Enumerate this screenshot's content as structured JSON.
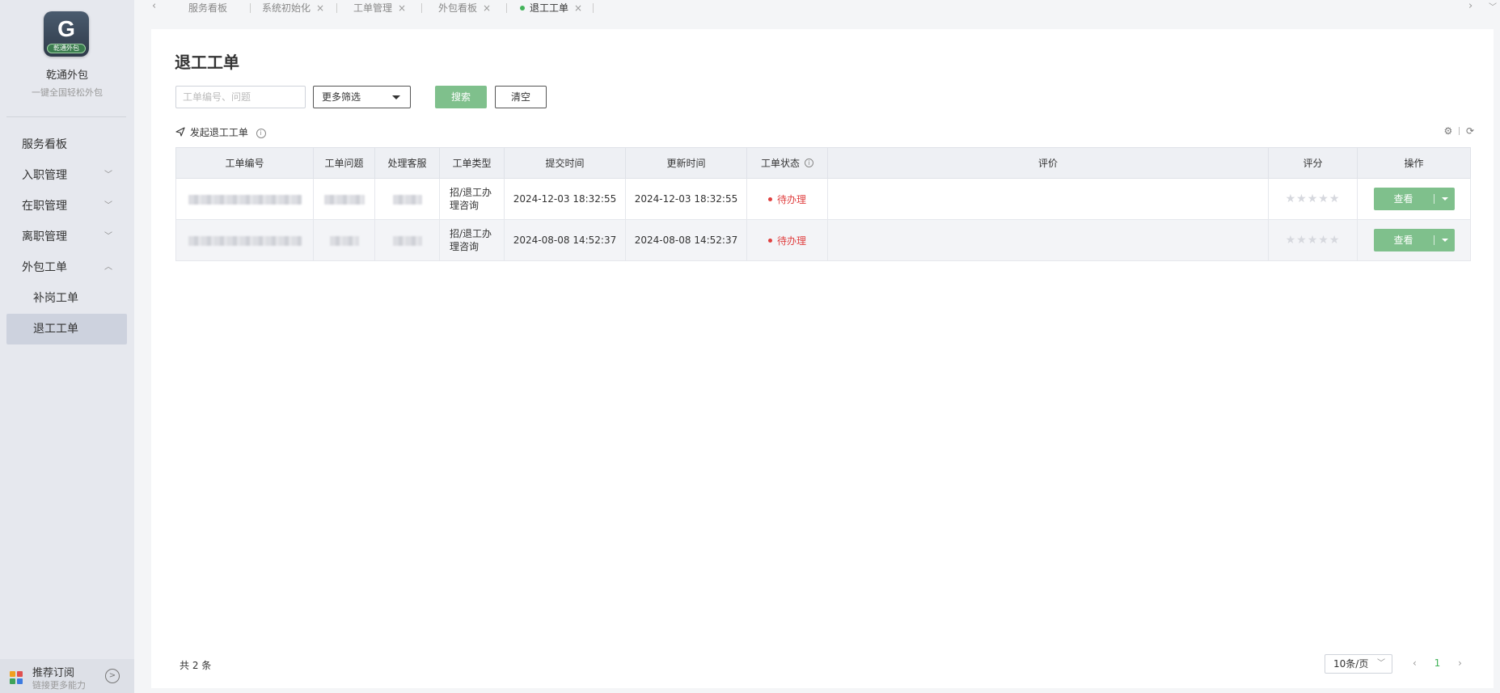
{
  "brand": {
    "logo_letter": "G",
    "logo_tag": "乾通外包",
    "name": "乾通外包",
    "slogan": "一键全国轻松外包"
  },
  "sidebar": {
    "items": [
      {
        "label": "服务看板",
        "chevron": ""
      },
      {
        "label": "入职管理",
        "chevron": "﹀"
      },
      {
        "label": "在职管理",
        "chevron": "﹀"
      },
      {
        "label": "离职管理",
        "chevron": "﹀"
      },
      {
        "label": "外包工单",
        "chevron": "︿"
      },
      {
        "label": "补岗工单",
        "chevron": ""
      },
      {
        "label": "退工工单",
        "chevron": ""
      }
    ],
    "subscription": {
      "title": "推荐订阅",
      "subtitle": "链接更多能力",
      "arrow": ">"
    }
  },
  "tabs": [
    {
      "label": "服务看板"
    },
    {
      "label": "系统初始化",
      "close": "×"
    },
    {
      "label": "工单管理",
      "close": "×"
    },
    {
      "label": "外包看板",
      "close": "×"
    },
    {
      "label": "退工工单",
      "close": "×"
    }
  ],
  "tab_nav": {
    "prev": "‹",
    "next": "›",
    "more": "﹀"
  },
  "page": {
    "title": "退工工单",
    "search_placeholder": "工单编号、问题",
    "filter_label": "更多筛选",
    "search_button": "搜索",
    "clear_button": "清空",
    "launch_label": "发起退工工单",
    "info_glyph": "i",
    "tools": {
      "settings": "⚙",
      "refresh": "⟳"
    }
  },
  "table": {
    "headers": [
      "工单编号",
      "工单问题",
      "处理客服",
      "工单类型",
      "提交时间",
      "更新时间",
      "工单状态",
      "评价",
      "评分",
      "操作"
    ],
    "rows": [
      {
        "type": "招/退工办理咨询",
        "submitted": "2024-12-03 18:32:55",
        "updated": "2024-12-03 18:32:55",
        "status": "待办理",
        "evaluation": "",
        "stars": "★★★★★",
        "action": "查看"
      },
      {
        "type": "招/退工办理咨询",
        "submitted": "2024-08-08 14:52:37",
        "updated": "2024-08-08 14:52:37",
        "status": "待办理",
        "evaluation": "",
        "stars": "★★★★★",
        "action": "查看"
      }
    ]
  },
  "footer": {
    "total": "共 2 条",
    "page_size": "10条/页",
    "prev": "‹",
    "current_page": "1",
    "next": "›",
    "chevron": "﹀"
  },
  "colors": {
    "primary": "#7fc08c",
    "status_pending": "#e04040",
    "active_tab_dot": "#43b35a"
  }
}
